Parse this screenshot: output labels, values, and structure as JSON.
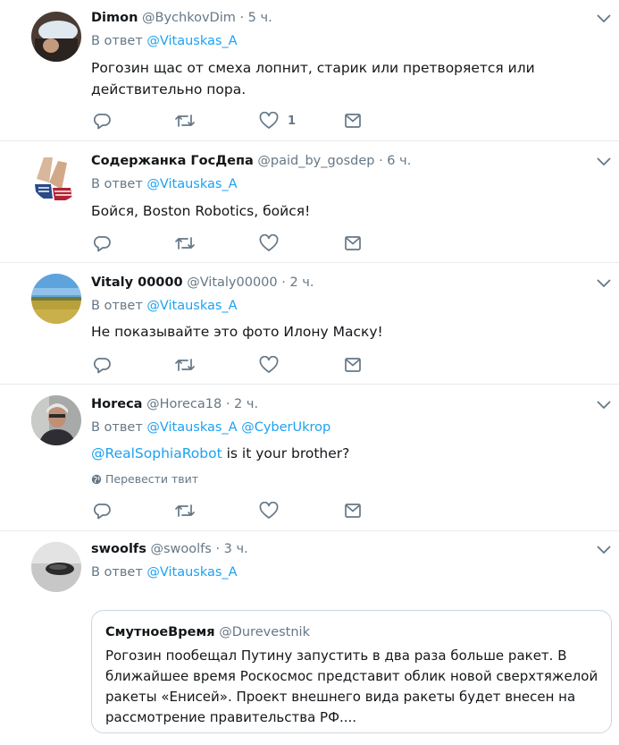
{
  "labels": {
    "reply_prefix": "В ответ",
    "translate": "Перевести твит"
  },
  "colors": {
    "accent": "#1da1f2",
    "muted": "#657786",
    "text": "#14171a",
    "divider": "#e6ecf0"
  },
  "tweets": [
    {
      "name": "Dimon",
      "handle": "@BychkovDim",
      "time": "· 5 ч.",
      "reply_to": "@Vitauskas_A",
      "text": "Рогозин щас от смеха лопнит, старик или претворяется или действительно пора.",
      "like_count": "1"
    },
    {
      "name": "Содержанка ГосДепа",
      "handle": "@paid_by_gosdep",
      "time": "· 6 ч.",
      "reply_to": "@Vitauskas_A",
      "text": "Бойся, Boston Robotics, бойся!"
    },
    {
      "name": "Vitaly 00000",
      "handle": "@Vitaly00000",
      "time": "· 2 ч.",
      "reply_to": "@Vitauskas_A",
      "text": "Не показывайте это фото Илону Маску!"
    },
    {
      "name": "Horeca",
      "handle": "@Horeca18",
      "time": "· 2 ч.",
      "reply_to": "@Vitauskas_A",
      "reply_to_2": "@CyberUkrop",
      "text_mention": "@RealSophiaRobot",
      "text": " is it your brother?"
    },
    {
      "name": "swoolfs",
      "handle": "@swoolfs",
      "time": "· 3 ч.",
      "reply_to": "@Vitauskas_A",
      "quote": {
        "name": "СмутноеВремя",
        "handle": "@Durevestnik",
        "text": "Рогозин пообещал Путину запустить в два раза больше ракет. В ближайшее время Роскосмос представит облик новой сверхтяжелой ракеты «Енисей». Проект внешнего вида ракеты будет внесен на рассмотрение правительства РФ...."
      }
    }
  ]
}
